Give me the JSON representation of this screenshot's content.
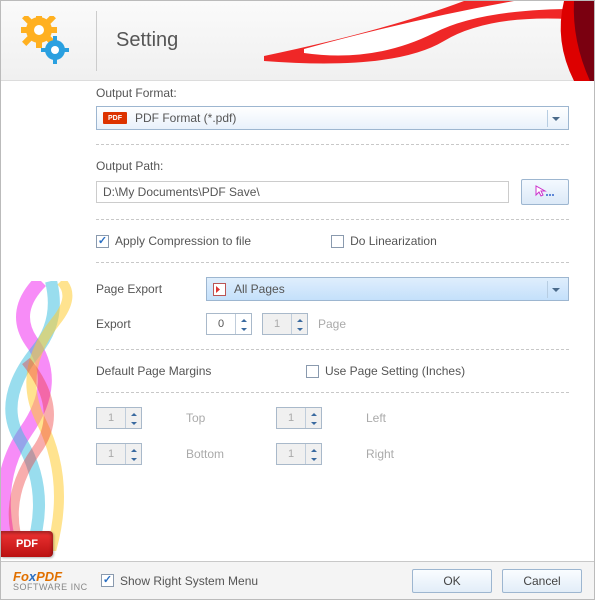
{
  "header": {
    "title": "Setting"
  },
  "outputFormat": {
    "label": "Output Format:",
    "badge": "PDF",
    "value": "PDF Format (*.pdf)"
  },
  "outputPath": {
    "label": "Output Path:",
    "value": "D:\\My Documents\\PDF Save\\"
  },
  "compression": {
    "label": "Apply Compression to file",
    "checked": true
  },
  "linearization": {
    "label": "Do Linearization",
    "checked": false
  },
  "pageExport": {
    "label": "Page Export",
    "value": "All Pages"
  },
  "export": {
    "label": "Export",
    "from": "0",
    "to": "1",
    "suffix": "Page"
  },
  "margins": {
    "title": "Default Page Margins",
    "usePageSetting": {
      "label": "Use Page Setting (Inches)",
      "checked": false
    },
    "top": {
      "label": "Top",
      "value": "1"
    },
    "bottom": {
      "label": "Bottom",
      "value": "1"
    },
    "left": {
      "label": "Left",
      "value": "1"
    },
    "right": {
      "label": "Right",
      "value": "1"
    }
  },
  "footer": {
    "showMenu": {
      "label": "Show Right System Menu",
      "checked": true
    },
    "ok": "OK",
    "cancel": "Cancel",
    "brand1": "Fo",
    "brand2": "x",
    "brand3": "PDF",
    "brand4": "SOFTWARE INC"
  },
  "pdfTab": "PDF"
}
